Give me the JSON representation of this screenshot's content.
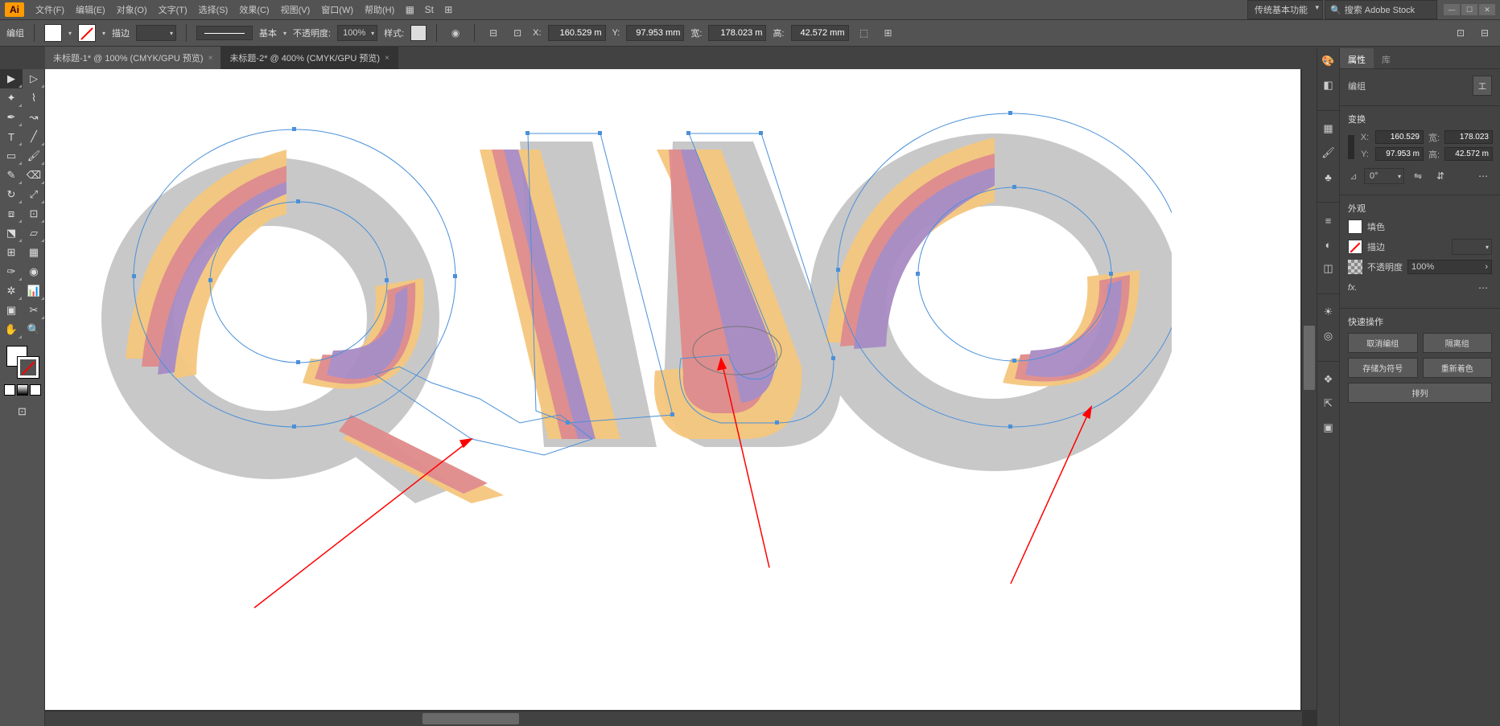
{
  "app": {
    "logo": "Ai"
  },
  "menu": {
    "file": "文件(F)",
    "edit": "编辑(E)",
    "object": "对象(O)",
    "type": "文字(T)",
    "select": "选择(S)",
    "effect": "效果(C)",
    "view": "视图(V)",
    "window": "窗口(W)",
    "help": "帮助(H)"
  },
  "workspace": "传统基本功能",
  "search_placeholder": "搜索 Adobe Stock",
  "control": {
    "mode": "编组",
    "stroke_label": "描边",
    "stroke_style": "基本",
    "opacity_label": "不透明度:",
    "opacity_value": "100%",
    "style_label": "样式:",
    "x_label": "X:",
    "x_value": "160.529 m",
    "y_label": "Y:",
    "y_value": "97.953 mm",
    "w_label": "宽:",
    "w_value": "178.023 m",
    "h_label": "高:",
    "h_value": "42.572 mm"
  },
  "tabs": [
    {
      "label": "未标题-1* @ 100% (CMYK/GPU 预览)",
      "active": false
    },
    {
      "label": "未标题-2* @ 400% (CMYK/GPU 预览)",
      "active": true
    }
  ],
  "props": {
    "tab_props": "属性",
    "tab_lib": "库",
    "header": "编组",
    "header_btn": "工",
    "transform_title": "变换",
    "x": "160.529",
    "w": "178.023",
    "y": "97.953 m",
    "h": "42.572 m",
    "angle_label": "⊿",
    "angle": "0°",
    "appearance_title": "外观",
    "fill_label": "填色",
    "stroke_label": "描边",
    "opacity_label": "不透明度",
    "opacity_value": "100%",
    "fx_label": "fx.",
    "quick_title": "快速操作",
    "btn_ungroup": "取消编组",
    "btn_isolate": "隔离组",
    "btn_savesym": "存储为符号",
    "btn_recolor": "重新着色",
    "btn_arrange": "排列"
  }
}
